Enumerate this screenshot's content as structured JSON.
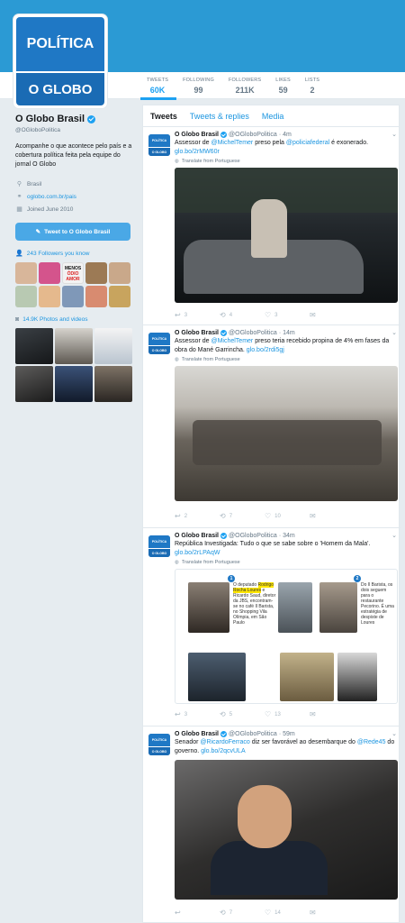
{
  "profile": {
    "avatar_top": "POLÍTICA",
    "avatar_bottom": "O GLOBO",
    "name": "O Globo Brasil",
    "handle": "@OGloboPolitica",
    "bio": "Acompanhe o que acontece pelo país e a cobertura política feita pela equipe do jornal O Globo",
    "location": "Brasil",
    "url": "oglobo.com.br/pais",
    "joined": "Joined June 2010",
    "tweet_to": "Tweet to O Globo Brasil",
    "followers_you_know": "243 Followers you know",
    "photos_videos": "14.9K Photos and videos"
  },
  "stats": [
    {
      "label": "TWEETS",
      "value": "60K"
    },
    {
      "label": "FOLLOWING",
      "value": "99"
    },
    {
      "label": "FOLLOWERS",
      "value": "211K"
    },
    {
      "label": "LIKES",
      "value": "59"
    },
    {
      "label": "LISTS",
      "value": "2"
    }
  ],
  "tabs": [
    "Tweets",
    "Tweets & replies",
    "Media"
  ],
  "tweets": [
    {
      "name": "O Globo Brasil",
      "handle": "@OGloboPolitica",
      "time": "· 4m",
      "text_parts": [
        "Assessor de ",
        "@MichelTemer",
        " preso pela ",
        "@policiafederal",
        " é exonerado. ",
        "glo.bo/2rMW60r"
      ],
      "translate": "Translate from Portuguese",
      "replies": "3",
      "retweets": "4",
      "likes": "3"
    },
    {
      "name": "O Globo Brasil",
      "handle": "@OGloboPolitica",
      "time": "· 14m",
      "text_parts": [
        "Assessor de ",
        "@MichelTemer",
        " preso teria recebido propina de 4% em fases da obra do Mané Garrincha. ",
        "glo.bo/2rdi5gj"
      ],
      "translate": "Translate from Portuguese",
      "replies": "2",
      "retweets": "7",
      "likes": "10"
    },
    {
      "name": "O Globo Brasil",
      "handle": "@OGloboPolitica",
      "time": "· 34m",
      "text_parts": [
        "República Investigada: Tudo o que se sabe sobre o 'Homem da Mala'. ",
        "glo.bo/2rLPAqW"
      ],
      "translate": "Translate from Portuguese",
      "replies": "3",
      "retweets": "5",
      "likes": "13",
      "infographic": {
        "badge1": "1",
        "badge2": "2",
        "text1_pre": "O deputado ",
        "text1_hl": "Rodrigo Rocha Loures",
        "text1_post": " e Ricardo Saud, diretor da JBS, encontram-se no café Il Barista, no Shopping Vila Olímpia, em São Paulo",
        "text2": "Do Il Barista, os dois seguem para o restaurante Pecorino. É uma estratégia de despiste de Loures"
      }
    },
    {
      "name": "O Globo Brasil",
      "handle": "@OGloboPolitica",
      "time": "· 59m",
      "text_parts": [
        "Senador ",
        "@RicardoFerraco",
        " diz ser favorável ao desembarque do ",
        "@Rede45",
        " do governo. ",
        "glo.bo/2qcvULA"
      ],
      "translate": "",
      "replies": "",
      "retweets": "7",
      "likes": "14"
    }
  ],
  "colors": {
    "banner": "#2b9ad4",
    "accent": "#1da1f2",
    "link": "#1b95e0",
    "avatar": "#1f78c5"
  }
}
